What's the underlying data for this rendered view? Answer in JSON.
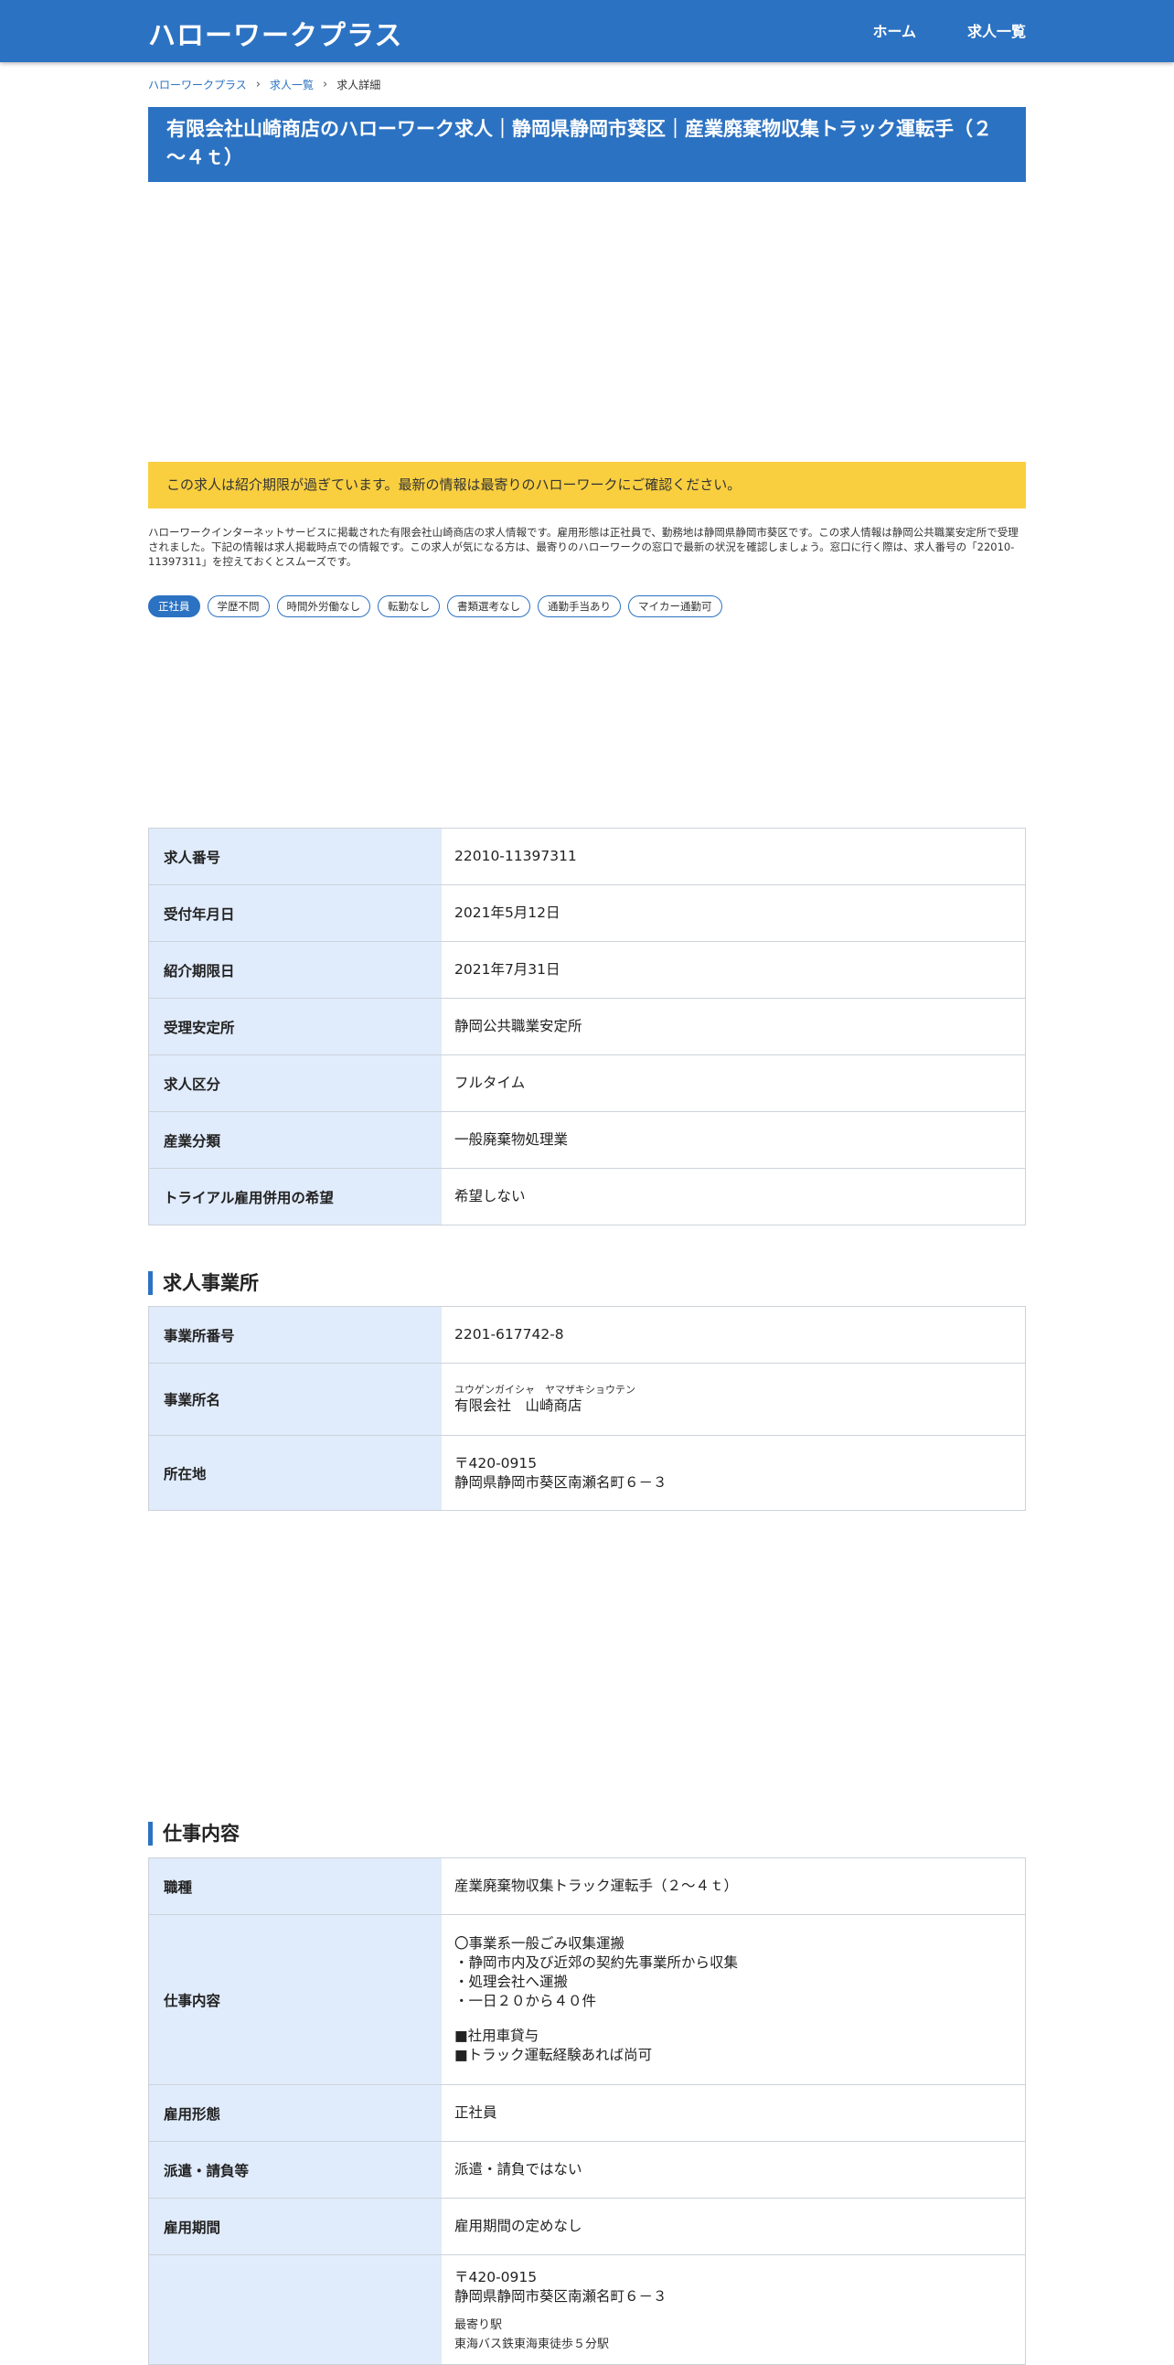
{
  "header": {
    "brand": "ハローワークプラス",
    "nav": {
      "home": "ホーム",
      "jobs": "求人一覧"
    }
  },
  "breadcrumb": {
    "home": "ハローワークプラス",
    "list": "求人一覧",
    "current": "求人詳細"
  },
  "title": "有限会社山崎商店のハローワーク求人｜静岡県静岡市葵区｜産業廃棄物収集トラック運転手（２～４ｔ）",
  "notice": "この求人は紹介期限が過ぎています。最新の情報は最寄りのハローワークにご確認ください。",
  "description": "ハローワークインターネットサービスに掲載された有限会社山崎商店の求人情報です。雇用形態は正社員で、勤務地は静岡県静岡市葵区です。この求人情報は静岡公共職業安定所で受理されました。下記の情報は求人掲載時点での情報です。この求人が気になる方は、最寄りのハローワークの窓口で最新の状況を確認しましょう。窓口に行く際は、求人番号の「22010-11397311」を控えておくとスムーズです。",
  "tags": {
    "t0": "正社員",
    "t1": "学歴不問",
    "t2": "時間外労働なし",
    "t3": "転勤なし",
    "t4": "書類選考なし",
    "t5": "通勤手当あり",
    "t6": "マイカー通勤可"
  },
  "basic": {
    "job_no_label": "求人番号",
    "job_no": "22010-11397311",
    "received_label": "受付年月日",
    "received": "2021年5月12日",
    "deadline_label": "紹介期限日",
    "deadline": "2021年7月31日",
    "office_label": "受理安定所",
    "office": "静岡公共職業安定所",
    "category_label": "求人区分",
    "category": "フルタイム",
    "industry_label": "産業分類",
    "industry": "一般廃棄物処理業",
    "trial_label": "トライアル雇用併用の希望",
    "trial": "希望しない"
  },
  "employer": {
    "heading": "求人事業所",
    "no_label": "事業所番号",
    "no": "2201-617742-8",
    "name_label": "事業所名",
    "name_kana": "ユウゲンガイシャ　ヤマザキショウテン",
    "name": "有限会社　山崎商店",
    "address_label": "所在地",
    "postal": "〒420-0915",
    "address": "静岡県静岡市葵区南瀬名町６－３"
  },
  "work": {
    "heading": "仕事内容",
    "type_label": "職種",
    "type": "産業廃棄物収集トラック運転手（２～４ｔ）",
    "content_label": "仕事内容",
    "content_1": "〇事業系一般ごみ収集運搬",
    "content_2": "・静岡市内及び近郊の契約先事業所から収集",
    "content_3": "・処理会社へ運搬",
    "content_4": "・一日２０から４０件",
    "content_5": "■社用車貸与",
    "content_6": "■トラック運転経験あれば尚可",
    "employment_label": "雇用形態",
    "employment": "正社員",
    "dispatch_label": "派遣・請負等",
    "dispatch": "派遣・請負ではない",
    "period_label": "雇用期間",
    "period": "雇用期間の定めなし",
    "place_postal": "〒420-0915",
    "place_address": "静岡県静岡市葵区南瀬名町６－３",
    "station_label": "最寄り駅",
    "station": "東海バス鉄東海東徒歩５分駅"
  }
}
